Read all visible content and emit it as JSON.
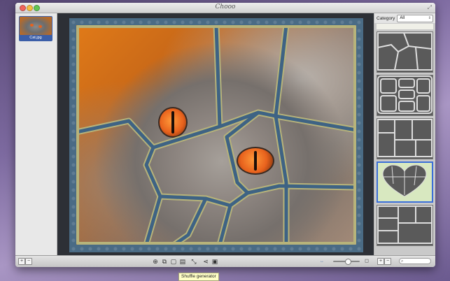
{
  "window": {
    "title": "Chooo"
  },
  "file_browser": {
    "items": [
      {
        "label": "Cat.jpg",
        "selected": true
      }
    ],
    "add_label": "+",
    "remove_label": "−"
  },
  "right_panel": {
    "category_label": "Category",
    "category_value": "All",
    "add_label": "+",
    "remove_label": "−",
    "search_placeholder": ""
  },
  "toolbar": {
    "icons": [
      "add-icon",
      "crop-icon",
      "export-icon",
      "text-icon",
      "shuffle-icon",
      "share-icon",
      "image-icon"
    ],
    "tooltip": "Shuffle generator",
    "zoom_level": 0.55
  },
  "colors": {
    "frame": "#4a6b85",
    "piece_border": "#b7b37a",
    "selection": "#3b6fd8",
    "canvas_bg": "#2d3036"
  }
}
